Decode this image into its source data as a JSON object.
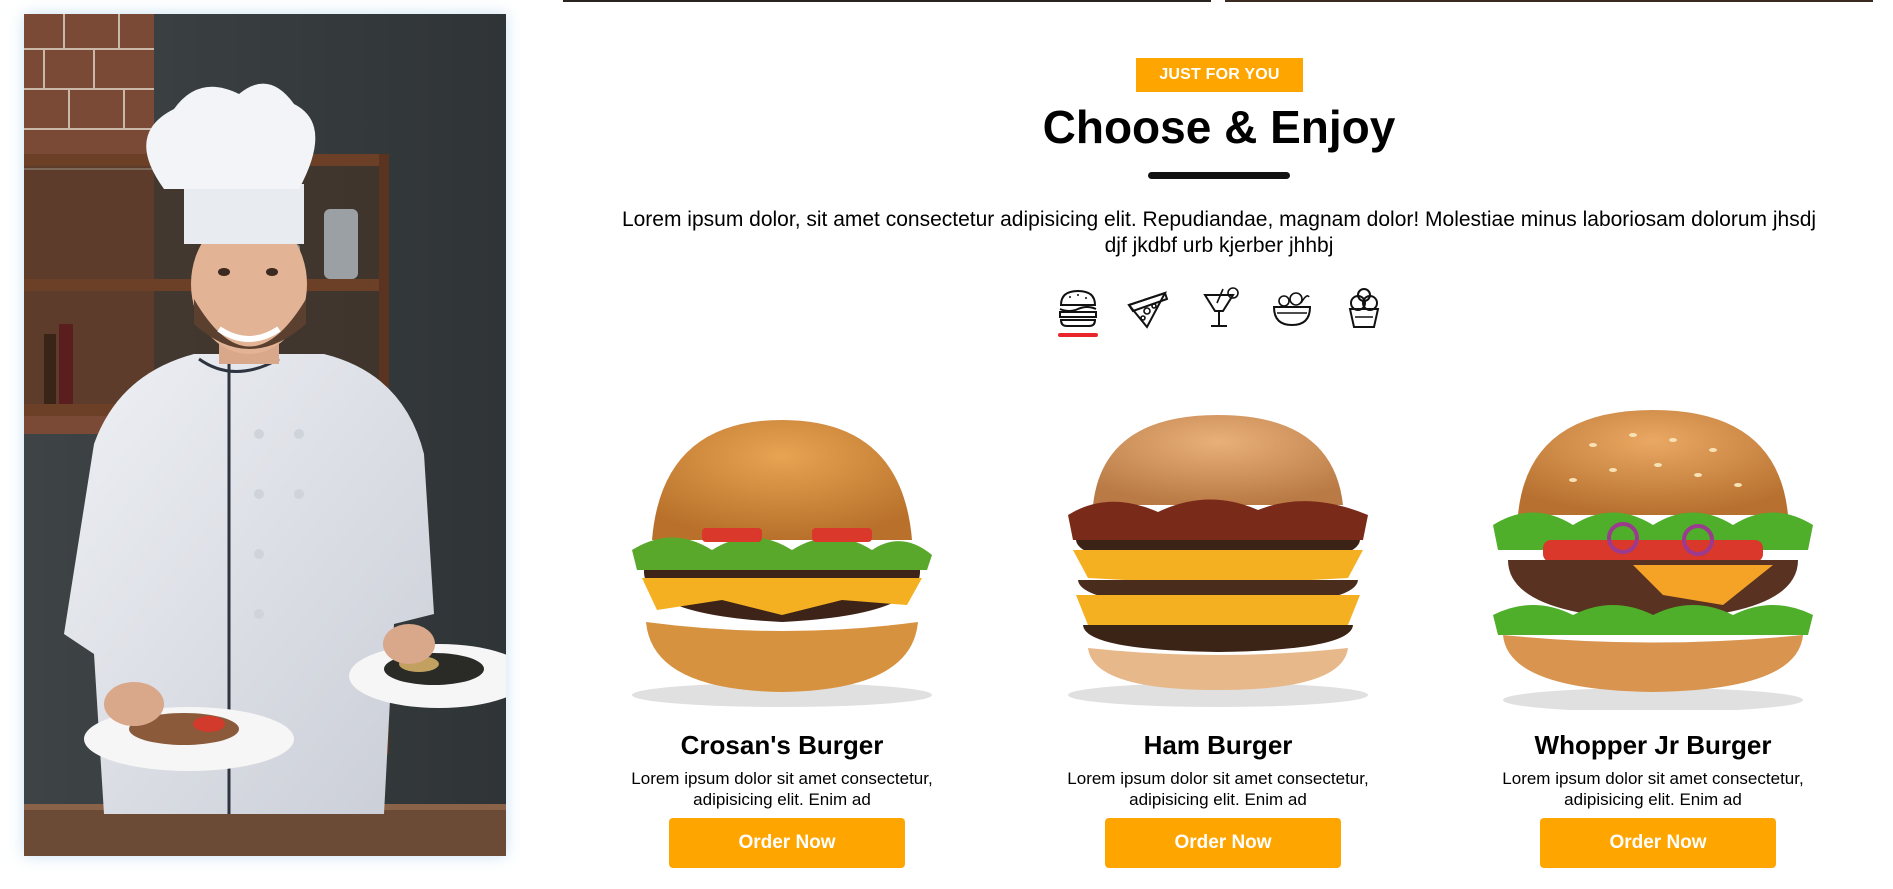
{
  "section": {
    "tag": "JUST FOR YOU",
    "title": "Choose & Enjoy",
    "description": "Lorem ipsum dolor, sit amet consectetur adipisicing elit. Repudiandae, magnam dolor! Molestiae minus laboriosam dolorum jhsdj djf jkdbf urb kjerber jhhbj"
  },
  "categories": [
    {
      "icon": "burger-icon",
      "active": true
    },
    {
      "icon": "pizza-icon",
      "active": false
    },
    {
      "icon": "drink-icon",
      "active": false
    },
    {
      "icon": "salad-icon",
      "active": false
    },
    {
      "icon": "ice-cream-icon",
      "active": false
    }
  ],
  "products": [
    {
      "name": "Crosan's Burger",
      "description": "Lorem ipsum dolor sit amet consectetur, adipisicing elit. Enim ad",
      "button": "Order Now"
    },
    {
      "name": "Ham Burger",
      "description": "Lorem ipsum dolor sit amet consectetur, adipisicing elit. Enim ad",
      "button": "Order Now"
    },
    {
      "name": "Whopper Jr Burger",
      "description": "Lorem ipsum dolor sit amet consectetur, adipisicing elit. Enim ad",
      "button": "Order Now"
    }
  ],
  "colors": {
    "accent": "#ffa500",
    "active_indicator": "#e8262b"
  }
}
